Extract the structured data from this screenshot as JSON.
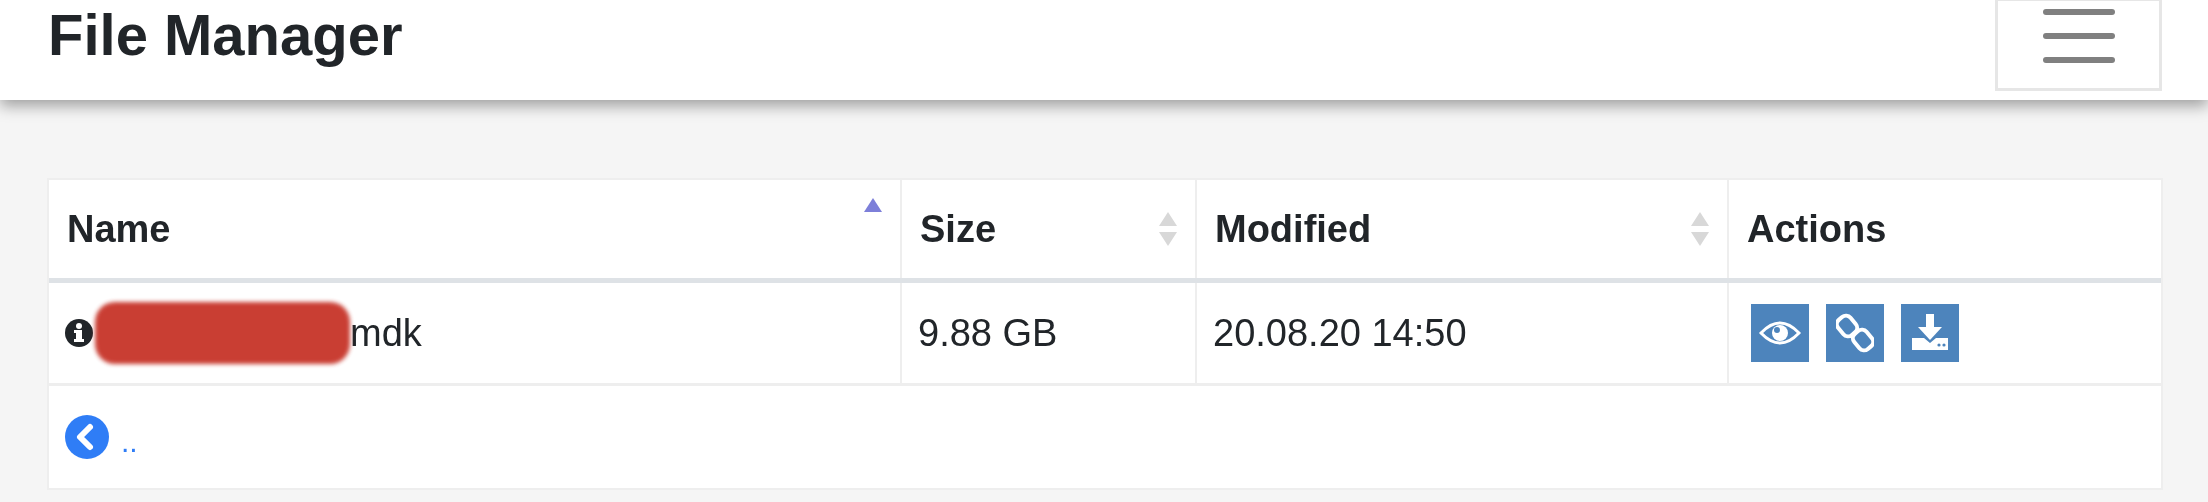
{
  "header": {
    "title": "File Manager"
  },
  "table": {
    "columns": [
      {
        "label": "Name",
        "sortable": true,
        "sorted": true
      },
      {
        "label": "Size",
        "sortable": true,
        "sorted": false
      },
      {
        "label": "Modified",
        "sortable": true,
        "sorted": false
      },
      {
        "label": "Actions",
        "sortable": false,
        "sorted": false
      }
    ],
    "rows": [
      {
        "name": "mdk",
        "redacted": true,
        "size": "9.88 GB",
        "modified": "20.08.20 14:50",
        "actions": [
          {
            "kind": "view"
          },
          {
            "kind": "link"
          },
          {
            "kind": "download"
          }
        ]
      }
    ],
    "parent_link": ".."
  }
}
